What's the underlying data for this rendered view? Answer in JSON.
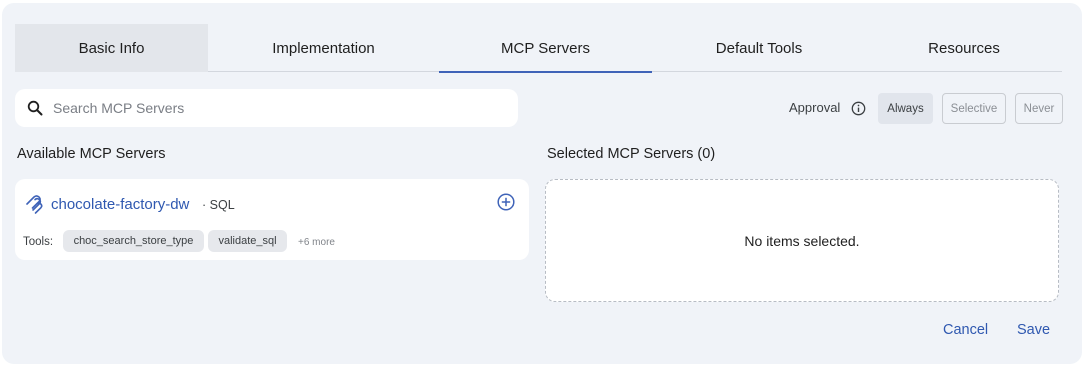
{
  "tabs": [
    {
      "label": "Basic Info"
    },
    {
      "label": "Implementation"
    },
    {
      "label": "MCP Servers"
    },
    {
      "label": "Default Tools"
    },
    {
      "label": "Resources"
    }
  ],
  "active_tab": "MCP Servers",
  "search": {
    "placeholder": "Search MCP Servers",
    "value": ""
  },
  "approval": {
    "label": "Approval",
    "options": [
      "Always",
      "Selective",
      "Never"
    ],
    "selected": "Always"
  },
  "available": {
    "title": "Available MCP Servers",
    "servers": [
      {
        "name": "chocolate-factory-dw",
        "separator": "·",
        "type": "SQL",
        "tools_label": "Tools:",
        "tools": [
          "choc_search_store_type",
          "validate_sql"
        ],
        "more": "+6 more"
      }
    ]
  },
  "selected": {
    "title": "Selected MCP Servers (0)",
    "empty_text": "No items selected."
  },
  "actions": {
    "cancel": "Cancel",
    "save": "Save"
  },
  "colors": {
    "accent": "#3f63b8",
    "link": "#2f58b0",
    "panel_bg": "#f0f3f8"
  }
}
